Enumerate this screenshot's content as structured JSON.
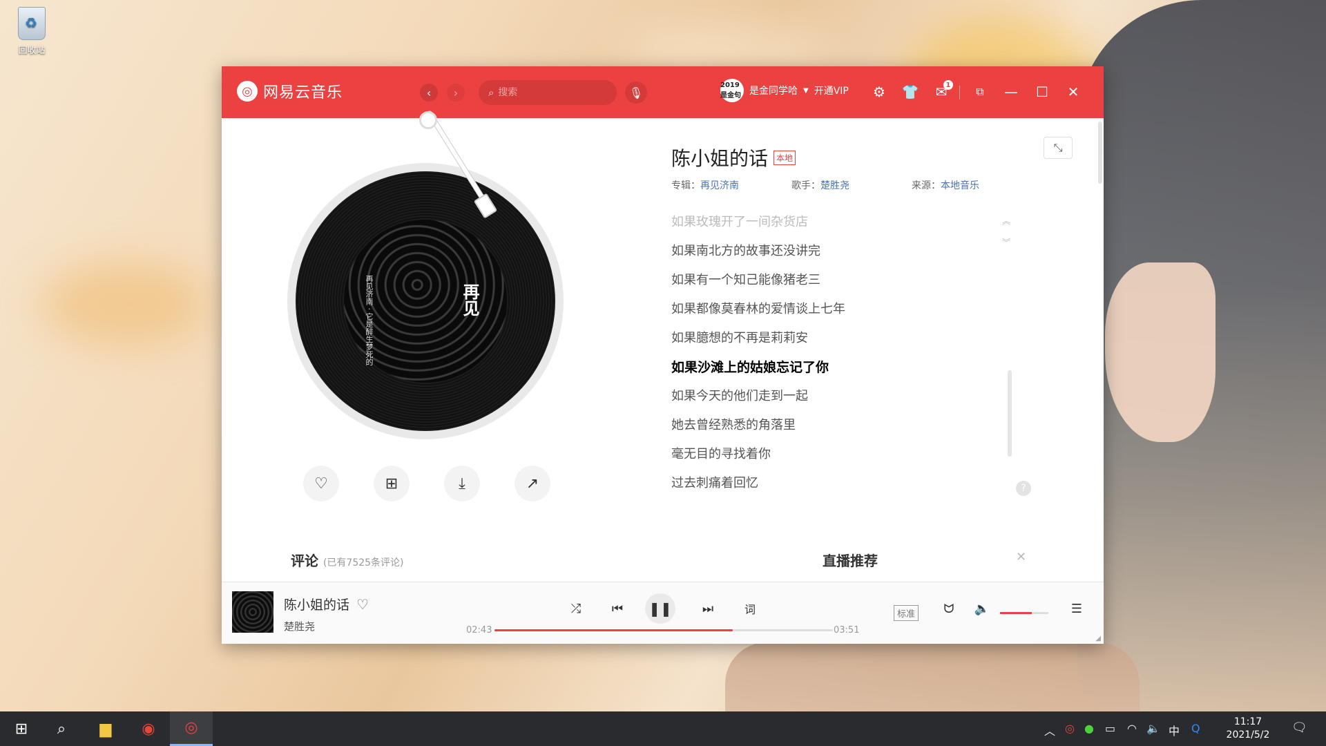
{
  "desktop": {
    "recycle_bin_label": "回收站"
  },
  "titlebar": {
    "app_name": "网易云音乐",
    "search_placeholder": "搜索",
    "avatar_text": "2019 是金句",
    "username": "是金同学哈",
    "vip_label": "开通VIP",
    "mail_badge": "1"
  },
  "song": {
    "title": "陈小姐的话",
    "tag": "本地",
    "album_label": "专辑：",
    "album": "再见济南",
    "artist_label": "歌手：",
    "artist": "楚胜尧",
    "source_label": "来源：",
    "source": "本地音乐",
    "cover_title": "再见",
    "cover_sub": "再见济南 · 它是醉生梦死的"
  },
  "lyrics": {
    "lines": [
      {
        "text": "如果玫瑰开了一间杂货店",
        "state": "faded"
      },
      {
        "text": "如果南北方的故事还没讲完",
        "state": "normal"
      },
      {
        "text": "如果有一个知己能像猪老三",
        "state": "normal"
      },
      {
        "text": "如果都像莫春林的爱情谈上七年",
        "state": "normal"
      },
      {
        "text": "如果臆想的不再是莉莉安",
        "state": "normal"
      },
      {
        "text": "如果沙滩上的姑娘忘记了你",
        "state": "active"
      },
      {
        "text": "如果今天的他们走到一起",
        "state": "normal"
      },
      {
        "text": "她去曾经熟悉的角落里",
        "state": "normal"
      },
      {
        "text": "毫无目的寻找着你",
        "state": "normal"
      },
      {
        "text": "过去刺痛着回忆",
        "state": "normal"
      }
    ]
  },
  "comments": {
    "title": "评论",
    "count_text": "(已有7525条评论)"
  },
  "live": {
    "title": "直播推荐"
  },
  "player": {
    "title": "陈小姐的话",
    "artist": "楚胜尧",
    "lyric_btn": "词",
    "current_time": "02:43",
    "total_time": "03:51",
    "progress": 0.705,
    "quality": "标准",
    "volume": 0.65
  },
  "taskbar": {
    "ime": "中",
    "time": "11:17",
    "date": "2021/5/2"
  },
  "colors": {
    "accent": "#ec4141"
  }
}
